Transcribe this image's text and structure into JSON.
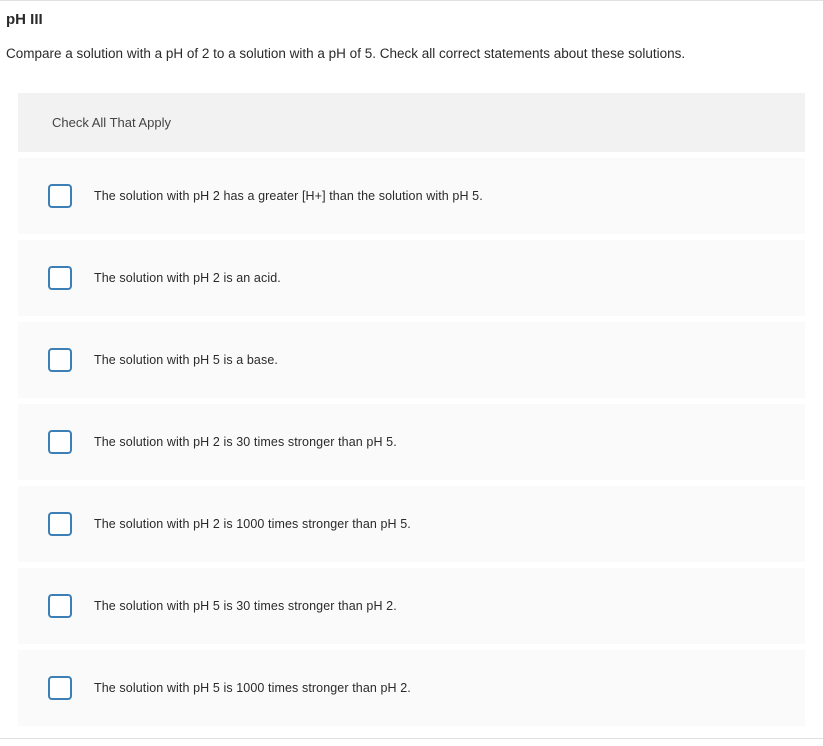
{
  "question": {
    "title": "pH III",
    "prompt": "Compare a solution with a pH of 2 to a solution with a pH of 5.  Check all correct statements about these solutions.",
    "instruction": "Check All That Apply"
  },
  "options": [
    {
      "label": "The solution with pH 2 has a greater [H+] than the solution with pH 5."
    },
    {
      "label": "The solution with pH 2 is an acid."
    },
    {
      "label": "The solution with pH 5 is a base."
    },
    {
      "label": "The solution with pH 2 is 30 times stronger than pH 5."
    },
    {
      "label": "The solution with pH 2 is 1000 times stronger than pH 5."
    },
    {
      "label": "The solution with pH 5 is 30 times stronger than pH 2."
    },
    {
      "label": "The solution with pH 5 is 1000 times stronger than pH 2."
    }
  ]
}
